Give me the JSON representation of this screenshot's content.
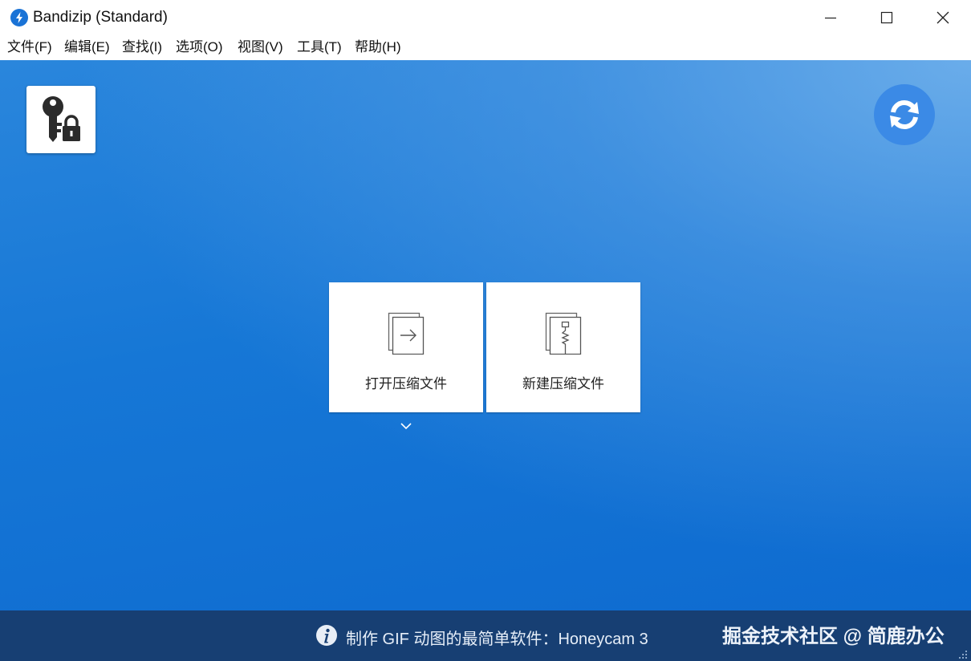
{
  "window": {
    "title": "Bandizip (Standard)",
    "app_icon": "bandizip-logo-icon",
    "controls": [
      "minimize-icon",
      "maximize-icon",
      "close-icon"
    ]
  },
  "menu": {
    "items": [
      {
        "label": "文件(F)"
      },
      {
        "label": "编辑(E)"
      },
      {
        "label": "查找(I)"
      },
      {
        "label": "选项(O)"
      },
      {
        "label": "视图(V)"
      },
      {
        "label": "工具(T)"
      },
      {
        "label": "帮助(H)"
      }
    ]
  },
  "main": {
    "password_manager_icon": "key-lock-icon",
    "refresh_icon": "refresh-icon",
    "tiles": [
      {
        "label": "打开压缩文件",
        "icon": "open-archive-icon"
      },
      {
        "label": "新建压缩文件",
        "icon": "new-archive-icon"
      }
    ],
    "more_options_icon": "chevron-down-icon"
  },
  "status": {
    "info_icon": "info-icon",
    "promo_text": "制作 GIF 动图的最简单软件：Honeycam 3",
    "watermark": "掘金技术社区 @ 简鹿办公"
  },
  "colors": {
    "accent": "#1a73d6",
    "background_top": "#2a86dc",
    "background_bottom": "#0e6bd0",
    "statusbar": "#173f73"
  }
}
